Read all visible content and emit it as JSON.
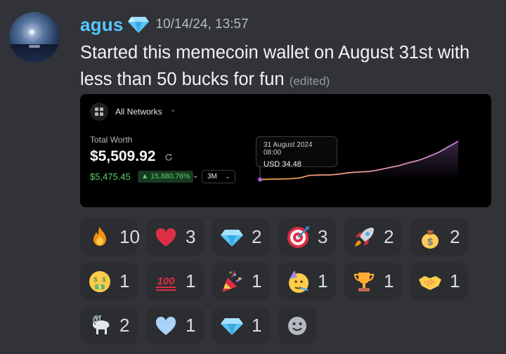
{
  "message": {
    "username": "agus",
    "timestamp": "10/14/24, 13:57",
    "text": "Started this memecoin wallet on August 31st with less than 50 bucks for fun",
    "edited_label": "(edited)"
  },
  "embed": {
    "network_label": "All Networks",
    "total_worth_label": "Total Worth",
    "total_worth_value": "$5,509.92",
    "change_value": "$5,475.45",
    "change_percent": "▲ 15,880.76%",
    "range": "3M",
    "tooltip_date": "31 August 2024 08:00",
    "tooltip_value": "USD 34.48"
  },
  "chart_data": {
    "type": "line",
    "title": "",
    "xlabel": "",
    "ylabel": "",
    "x": [
      0,
      5,
      10,
      15,
      20,
      25,
      30,
      35,
      40,
      45,
      50,
      55,
      60,
      65,
      70,
      75,
      80,
      85,
      90,
      95,
      100
    ],
    "series": [
      {
        "values": [
          34.48,
          90,
          110,
          150,
          260,
          640,
          680,
          690,
          820,
          1020,
          1120,
          1180,
          1430,
          1730,
          2010,
          2420,
          2780,
          3300,
          3900,
          4700,
          5509.92
        ]
      }
    ],
    "colors": {
      "start": "#f0a23a",
      "end": "#c98ae6"
    }
  },
  "reactions": [
    {
      "emoji": "fire-icon",
      "count": "10"
    },
    {
      "emoji": "heart-icon",
      "count": "3"
    },
    {
      "emoji": "gem-icon",
      "count": "2"
    },
    {
      "emoji": "dart-icon",
      "count": "3"
    },
    {
      "emoji": "rocket-icon",
      "count": "2"
    },
    {
      "emoji": "money-bag-icon",
      "count": "2"
    },
    {
      "emoji": "money-mouth-face-icon",
      "count": "1"
    },
    {
      "emoji": "hundred-points-icon",
      "count": "1"
    },
    {
      "emoji": "party-popper-icon",
      "count": "1"
    },
    {
      "emoji": "partying-face-icon",
      "count": "1"
    },
    {
      "emoji": "trophy-icon",
      "count": "1"
    },
    {
      "emoji": "handshake-icon",
      "count": "1"
    },
    {
      "emoji": "goat-icon",
      "count": "2"
    },
    {
      "emoji": "light-blue-heart-icon",
      "count": "1"
    },
    {
      "emoji": "gem-icon",
      "count": "1"
    },
    {
      "emoji": "add-reaction-icon",
      "count": ""
    }
  ]
}
